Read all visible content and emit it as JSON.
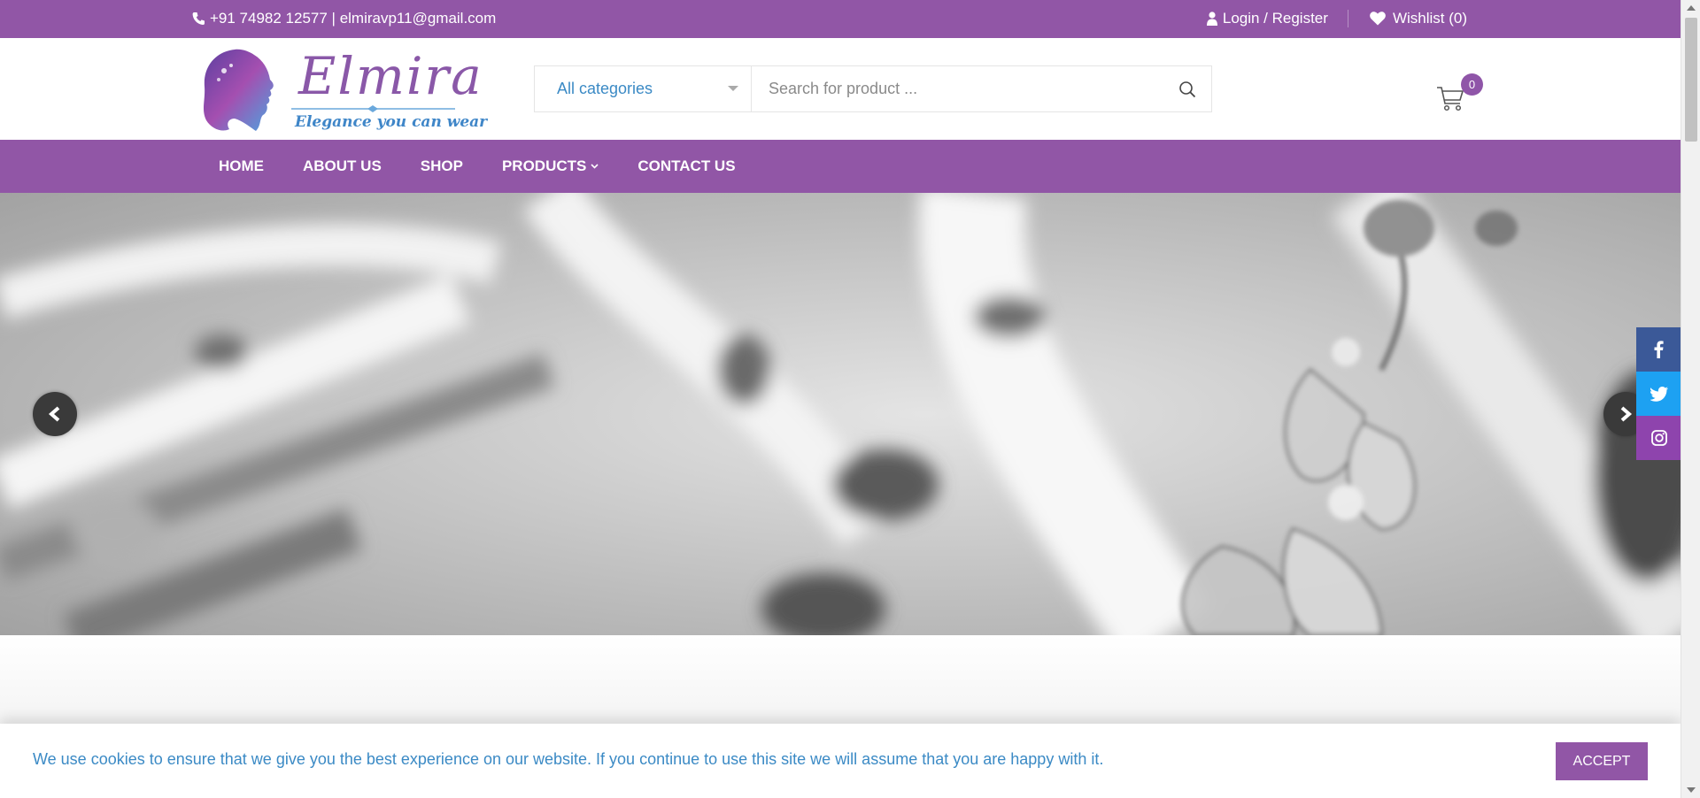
{
  "topbar": {
    "contact": "+91 74982 12577 | elmiravp11@gmail.com",
    "login": "Login / Register",
    "wishlist": "Wishlist (0)"
  },
  "header": {
    "logo_brand": "Elmira",
    "logo_tagline": "Elegance you can wear",
    "category_selected": "All categories",
    "search_placeholder": "Search for product ...",
    "cart_count": "0"
  },
  "nav": {
    "items": [
      {
        "label": "HOME"
      },
      {
        "label": "ABOUT US"
      },
      {
        "label": "SHOP"
      },
      {
        "label": "PRODUCTS"
      },
      {
        "label": "CONTACT US"
      }
    ]
  },
  "social": [
    "facebook",
    "twitter",
    "instagram"
  ],
  "cookie": {
    "message": "We use cookies to ensure that we give you the best experience on our website. If you continue to use this site we will assume that you are happy with it.",
    "accept": "ACCEPT"
  },
  "colors": {
    "brand_purple": "#9156a6",
    "link_blue": "#3b8ac5",
    "facebook": "#3b5998",
    "twitter": "#1da1f2",
    "instagram": "#8e44ad"
  }
}
